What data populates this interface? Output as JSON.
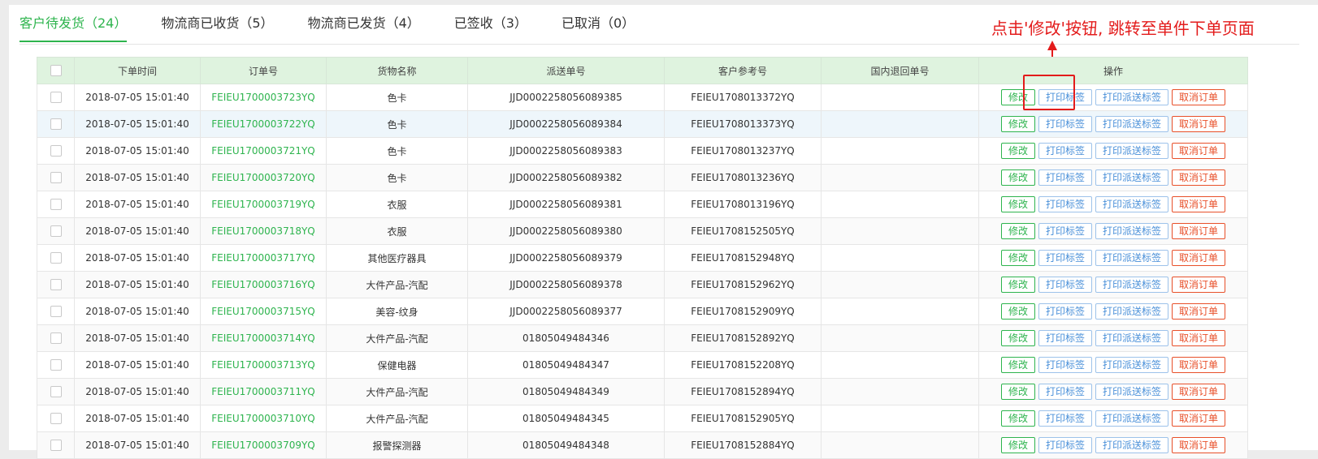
{
  "tabs": [
    {
      "label": "客户待发货（24）",
      "active": true
    },
    {
      "label": "物流商已收货（5）",
      "active": false
    },
    {
      "label": "物流商已发货（4）",
      "active": false
    },
    {
      "label": "已签收（3）",
      "active": false
    },
    {
      "label": "已取消（0）",
      "active": false
    }
  ],
  "annotation": {
    "text": "点击'修改'按钮, 跳转至单件下单页面",
    "color": "#e31b1b"
  },
  "table": {
    "headers": [
      "",
      "下单时间",
      "订单号",
      "货物名称",
      "派送单号",
      "客户参考号",
      "国内退回单号",
      "操作"
    ],
    "actions": {
      "edit": "修改",
      "print_label": "打印标签",
      "print_delivery_label": "打印派送标签",
      "cancel_order": "取消订单"
    },
    "rows": [
      {
        "time": "2018-07-05 15:01:40",
        "order_no": "FEIEU1700003723YQ",
        "goods": "色卡",
        "delivery_no": "JJD0002258056089385",
        "ref_no": "FEIEU1708013372YQ",
        "return_no": ""
      },
      {
        "time": "2018-07-05 15:01:40",
        "order_no": "FEIEU1700003722YQ",
        "goods": "色卡",
        "delivery_no": "JJD0002258056089384",
        "ref_no": "FEIEU1708013373YQ",
        "return_no": ""
      },
      {
        "time": "2018-07-05 15:01:40",
        "order_no": "FEIEU1700003721YQ",
        "goods": "色卡",
        "delivery_no": "JJD0002258056089383",
        "ref_no": "FEIEU1708013237YQ",
        "return_no": ""
      },
      {
        "time": "2018-07-05 15:01:40",
        "order_no": "FEIEU1700003720YQ",
        "goods": "色卡",
        "delivery_no": "JJD0002258056089382",
        "ref_no": "FEIEU1708013236YQ",
        "return_no": ""
      },
      {
        "time": "2018-07-05 15:01:40",
        "order_no": "FEIEU1700003719YQ",
        "goods": "衣服",
        "delivery_no": "JJD0002258056089381",
        "ref_no": "FEIEU1708013196YQ",
        "return_no": ""
      },
      {
        "time": "2018-07-05 15:01:40",
        "order_no": "FEIEU1700003718YQ",
        "goods": "衣服",
        "delivery_no": "JJD0002258056089380",
        "ref_no": "FEIEU1708152505YQ",
        "return_no": ""
      },
      {
        "time": "2018-07-05 15:01:40",
        "order_no": "FEIEU1700003717YQ",
        "goods": "其他医疗器具",
        "delivery_no": "JJD0002258056089379",
        "ref_no": "FEIEU1708152948YQ",
        "return_no": ""
      },
      {
        "time": "2018-07-05 15:01:40",
        "order_no": "FEIEU1700003716YQ",
        "goods": "大件产品-汽配",
        "delivery_no": "JJD0002258056089378",
        "ref_no": "FEIEU1708152962YQ",
        "return_no": ""
      },
      {
        "time": "2018-07-05 15:01:40",
        "order_no": "FEIEU1700003715YQ",
        "goods": "美容-纹身",
        "delivery_no": "JJD0002258056089377",
        "ref_no": "FEIEU1708152909YQ",
        "return_no": ""
      },
      {
        "time": "2018-07-05 15:01:40",
        "order_no": "FEIEU1700003714YQ",
        "goods": "大件产品-汽配",
        "delivery_no": "01805049484346",
        "ref_no": "FEIEU1708152892YQ",
        "return_no": ""
      },
      {
        "time": "2018-07-05 15:01:40",
        "order_no": "FEIEU1700003713YQ",
        "goods": "保健电器",
        "delivery_no": "01805049484347",
        "ref_no": "FEIEU1708152208YQ",
        "return_no": ""
      },
      {
        "time": "2018-07-05 15:01:40",
        "order_no": "FEIEU1700003711YQ",
        "goods": "大件产品-汽配",
        "delivery_no": "01805049484349",
        "ref_no": "FEIEU1708152894YQ",
        "return_no": ""
      },
      {
        "time": "2018-07-05 15:01:40",
        "order_no": "FEIEU1700003710YQ",
        "goods": "大件产品-汽配",
        "delivery_no": "01805049484345",
        "ref_no": "FEIEU1708152905YQ",
        "return_no": ""
      },
      {
        "time": "2018-07-05 15:01:40",
        "order_no": "FEIEU1700003709YQ",
        "goods": "报警探测器",
        "delivery_no": "01805049484348",
        "ref_no": "FEIEU1708152884YQ",
        "return_no": ""
      }
    ]
  }
}
